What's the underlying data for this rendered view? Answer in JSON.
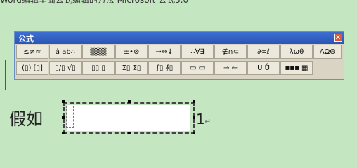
{
  "top_text": "Word编辑里面公式编辑的方法 Microsoft 公式3.0",
  "toolbar": {
    "title": "公式",
    "close_symbol": "✕",
    "row1": [
      "≤≠≈",
      "ȧ ab∴",
      "▒▒▒",
      "±•⊗",
      "→⇔↓",
      "∴∀∃",
      "∉∩⊂",
      "∂∞ℓ",
      "λωθ",
      "ΛΩΘ"
    ],
    "row2": [
      "(▯) [▯]",
      "▯/▯ √▯",
      "▯▯ ▯",
      "Σ▯ Σ▯",
      "∫▯ ∮▯",
      "▭ ▭",
      "→ ←",
      "Ū Ů",
      "▪▪▪ ▦"
    ]
  },
  "doc": {
    "prefix": "假如",
    "after": "1",
    "para_mark": "↵"
  }
}
